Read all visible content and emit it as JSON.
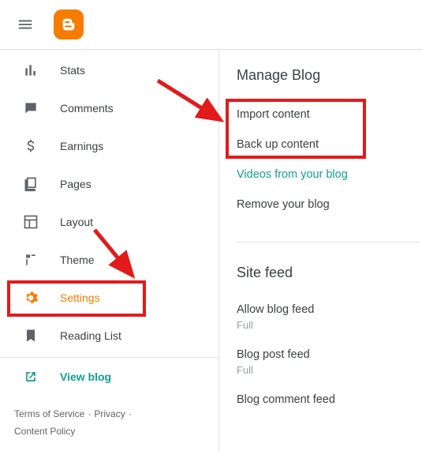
{
  "sidebar": {
    "items": [
      {
        "label": "Stats"
      },
      {
        "label": "Comments"
      },
      {
        "label": "Earnings"
      },
      {
        "label": "Pages"
      },
      {
        "label": "Layout"
      },
      {
        "label": "Theme"
      },
      {
        "label": "Settings"
      },
      {
        "label": "Reading List"
      }
    ],
    "view_blog": "View blog"
  },
  "footer": {
    "tos": "Terms of Service",
    "privacy": "Privacy",
    "content_policy": "Content Policy"
  },
  "content": {
    "manage_heading": "Manage Blog",
    "import": "Import content",
    "backup": "Back up content",
    "videos": "Videos from your blog",
    "remove": "Remove your blog",
    "sitefeed_heading": "Site feed",
    "allow_feed_label": "Allow blog feed",
    "allow_feed_value": "Full",
    "post_feed_label": "Blog post feed",
    "post_feed_value": "Full",
    "comment_feed_label": "Blog comment feed"
  }
}
